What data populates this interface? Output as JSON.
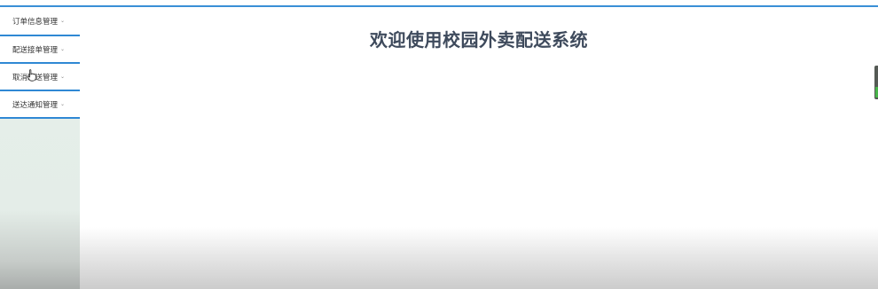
{
  "header": {
    "title": "欢迎使用校园外卖配送系统"
  },
  "sidebar": {
    "items": [
      {
        "label": "订单信息管理",
        "chevron": "chevron-down-icon"
      },
      {
        "label": "配送接单管理",
        "chevron": "chevron-down-icon"
      },
      {
        "label": "取消配送管理",
        "chevron": "chevron-down-icon"
      },
      {
        "label": "送达通知管理",
        "chevron": "chevron-down-icon"
      }
    ]
  },
  "colors": {
    "accent_line": "#2f88d4",
    "title_text": "#3e4a5c",
    "sidebar_bg": "#e6efea"
  }
}
